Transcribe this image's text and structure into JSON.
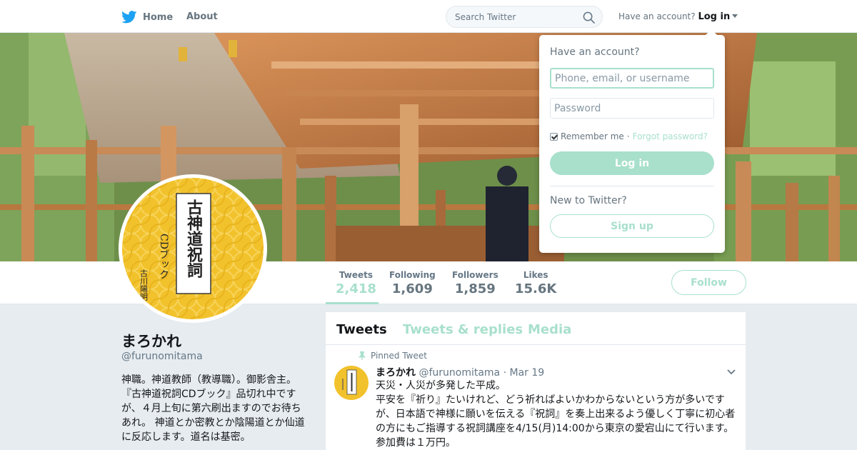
{
  "colors": {
    "accent": "#a8e0cc",
    "twitter_blue": "#1da1f2",
    "text_primary": "#14171a",
    "text_secondary": "#657786",
    "background": "#e6ecf0",
    "banner_wood": "#b5733e",
    "avatar_gold": "#f2c22c"
  },
  "nav": {
    "logo_icon": "twitter-bird-icon",
    "home_label": "Home",
    "about_label": "About",
    "search_placeholder": "Search Twitter",
    "search_icon": "search-icon",
    "have_account_label": "Have an account?",
    "login_label": "Log in"
  },
  "login_dropdown": {
    "title": "Have an account?",
    "username_placeholder": "Phone, email, or username",
    "password_placeholder": "Password",
    "remember_label": "Remember me",
    "separator": "·",
    "forgot_label": "Forgot password?",
    "login_button": "Log in",
    "new_label": "New to Twitter?",
    "signup_button": "Sign up"
  },
  "avatar_artwork": {
    "title_text": "古神道祝詞",
    "subtitle_text": "CDブック",
    "author_text": "古川陽明"
  },
  "stats": [
    {
      "label": "Tweets",
      "value": "2,418",
      "active": true
    },
    {
      "label": "Following",
      "value": "1,609",
      "active": false
    },
    {
      "label": "Followers",
      "value": "1,859",
      "active": false
    },
    {
      "label": "Likes",
      "value": "15.6K",
      "active": false
    }
  ],
  "follow_button": "Follow",
  "profile": {
    "name": "まろかれ",
    "handle": "@furunomitama",
    "bio": "神職。神道教師（教導職）。御影舎主。『古神道祝詞CDブック』品切れ中ですが、４月上旬に第六刷出ますのでお待ちあれ。 神道とか密教とか陰陽道とか仙道に反応します。道名は基密。"
  },
  "timeline": {
    "tabs": [
      "Tweets",
      "Tweets & replies",
      "Media"
    ],
    "pinned_label": "Pinned Tweet",
    "tweet": {
      "author": "まろかれ",
      "handle": "@furunomitama",
      "separator": "·",
      "date": "Mar 19",
      "text": "天災・人災が多発した平成。\n平安を『祈り』たいけれど、どう祈ればよいかわからないという方が多いですが、日本語で神様に願いを伝える『祝詞』を奏上出来るよう優しく丁寧に初心者の方にもご指導する祝詞講座を4/15(月)14:00から東京の愛宕山にて行います。参加費は１万円。"
    }
  }
}
